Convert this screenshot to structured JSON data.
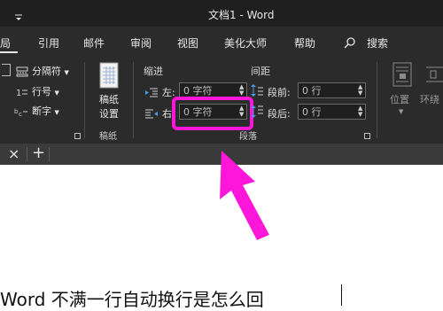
{
  "window": {
    "title": "文档1  -  Word"
  },
  "tabs": [
    "局",
    "引用",
    "邮件",
    "审阅",
    "视图",
    "美化大师",
    "帮助"
  ],
  "search": {
    "label": "搜索"
  },
  "ribbon": {
    "left_group": {
      "items": [
        "分隔符",
        "行号",
        "断字"
      ]
    },
    "paper_button": {
      "line1": "稿纸",
      "line2": "设置"
    },
    "paper_group_label": "稿纸",
    "paragraph": {
      "indent_label": "缩进",
      "spacing_label": "间距",
      "indent_left": {
        "label": "左:",
        "value": "0 字符"
      },
      "indent_right": {
        "label": "右",
        "value": "0 字符"
      },
      "spacing_before": {
        "label": "段前:",
        "value": "0 行"
      },
      "spacing_after": {
        "label": "段后:",
        "value": "0 行"
      },
      "group_label": "段落"
    },
    "position": {
      "label": "位置"
    },
    "wrap": {
      "label": "环绕"
    }
  },
  "document": {
    "close_symbol": "×",
    "add_symbol": "+",
    "body_text": "Word 不满一行自动换行是怎么回"
  },
  "colors": {
    "highlight": "#ff16d9",
    "ribbon_bg": "#2b2b2b",
    "title_bg": "#1f1f1f"
  }
}
